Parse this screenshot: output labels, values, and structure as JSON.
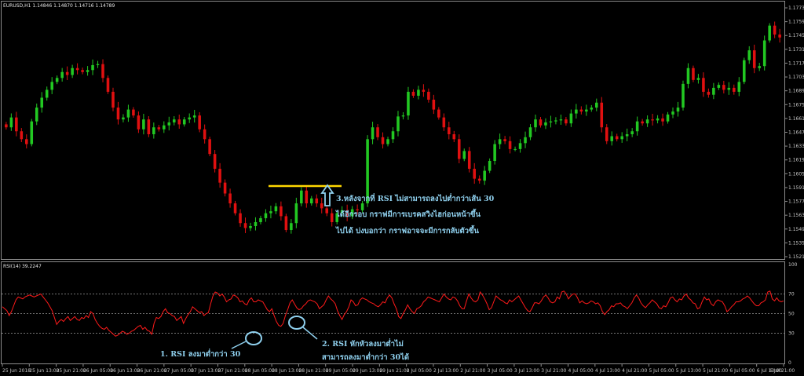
{
  "header": {
    "symbol": "EURUSD,H1",
    "ohlc": "1.14846 1.14870 1.14716 1.14789"
  },
  "rsi_header": {
    "label": "RSI(14) 39.2247"
  },
  "colors": {
    "bull": "#22c822",
    "bear": "#e01010",
    "rsi_line": "#ff1a1a",
    "resistance": "#ffd700",
    "annotation": "#8fd0ee",
    "grid_frame": "#8c8c8c"
  },
  "annotations": {
    "note3": [
      "3.หลังจากที่ RSI ไม่สามารถลงไปต่ำกว่าเส้น 30",
      "ได้อีกรอบ กราฟมีการเบรคสวิงไฮก่อนหน้าขึ้น",
      "ไปได้ บ่งบอกว่า กราฟอาจจะมีการกลับตัวขึ้น"
    ],
    "note1": "1. RSI ลงมาต่ำกว่า 30",
    "note2": [
      "2. RSI หักหัวลงมาต่ำไม่",
      "สามารถลงมาต่ำกว่า 30ได้"
    ]
  },
  "chart_data": [
    {
      "type": "candlestick",
      "title": "EURUSD,H1",
      "ylim": [
        1.1521,
        1.1773
      ],
      "y_ticks": [
        "1.17730",
        "1.17590",
        "1.17450",
        "1.17310",
        "1.17170",
        "1.17030",
        "1.16890",
        "1.16750",
        "1.16610",
        "1.16470",
        "1.16330",
        "1.16190",
        "1.16050",
        "1.15910",
        "1.15770",
        "1.15630",
        "1.15490",
        "1.15350",
        "1.15210"
      ],
      "x_ticks": [
        "25 Jun 2018",
        "25 Jun 13:00",
        "25 Jun 21:00",
        "26 Jun 05:00",
        "26 Jun 13:00",
        "26 Jun 21:00",
        "27 Jun 05:00",
        "27 Jun 13:00",
        "27 Jun 21:00",
        "28 Jun 05:00",
        "28 Jun 13:00",
        "28 Jun 21:00",
        "29 Jun 05:00",
        "29 Jun 13:00",
        "29 Jun 21:00",
        "2 Jul 05:00",
        "2 Jul 13:00",
        "2 Jul 21:00",
        "3 Jul 05:00",
        "3 Jul 13:00",
        "3 Jul 21:00",
        "4 Jul 05:00",
        "4 Jul 13:00",
        "4 Jul 21:00",
        "5 Jul 05:00",
        "5 Jul 13:00",
        "5 Jul 21:00",
        "6 Jul 05:00",
        "6 Jul 13:00",
        "6 Jul 21:00"
      ],
      "price_path": [
        1.1655,
        1.1652,
        1.1662,
        1.1648,
        1.164,
        1.1635,
        1.1658,
        1.1672,
        1.1682,
        1.169,
        1.1698,
        1.1702,
        1.1708,
        1.1705,
        1.1712,
        1.171,
        1.1708,
        1.171,
        1.1715,
        1.1716,
        1.1702,
        1.1688,
        1.1672,
        1.166,
        1.1662,
        1.167,
        1.1664,
        1.165,
        1.166,
        1.1645,
        1.1652,
        1.165,
        1.1654,
        1.1657,
        1.166,
        1.1655,
        1.166,
        1.1662,
        1.1664,
        1.165,
        1.164,
        1.1625,
        1.161,
        1.1596,
        1.1585,
        1.1575,
        1.1565,
        1.1555,
        1.155,
        1.1552,
        1.1556,
        1.156,
        1.1565,
        1.1567,
        1.1572,
        1.1562,
        1.1548,
        1.1555,
        1.1575,
        1.1588,
        1.1575,
        1.158,
        1.1575,
        1.157,
        1.1565,
        1.1556,
        1.1565,
        1.1568,
        1.1562,
        1.1569,
        1.1568,
        1.1575,
        1.164,
        1.1652,
        1.1642,
        1.1635,
        1.164,
        1.1648,
        1.1663,
        1.1664,
        1.1688,
        1.1684,
        1.169,
        1.1688,
        1.168,
        1.167,
        1.1662,
        1.1652,
        1.1645,
        1.164,
        1.162,
        1.1628,
        1.161,
        1.16,
        1.1598,
        1.1608,
        1.1618,
        1.1635,
        1.164,
        1.1638,
        1.163,
        1.163,
        1.1636,
        1.1642,
        1.1652,
        1.166,
        1.1654,
        1.1657,
        1.1658,
        1.1659,
        1.166,
        1.1656,
        1.1666,
        1.167,
        1.1668,
        1.167,
        1.1672,
        1.1677,
        1.1652,
        1.1638,
        1.1643,
        1.164,
        1.1643,
        1.1645,
        1.1648,
        1.1658,
        1.1656,
        1.166,
        1.1659,
        1.1661,
        1.1658,
        1.1665,
        1.1668,
        1.1672,
        1.1696,
        1.1712,
        1.17,
        1.1702,
        1.1688,
        1.1685,
        1.1692,
        1.1695,
        1.169,
        1.1692,
        1.1688,
        1.1698,
        1.172,
        1.173,
        1.1712,
        1.1714,
        1.174,
        1.1755,
        1.1746,
        1.1743
      ]
    },
    {
      "type": "line",
      "title": "RSI(14) 39.2247",
      "ylim": [
        0,
        100
      ],
      "levels": [
        70,
        50,
        30
      ],
      "y_ticks": [
        "100",
        "70",
        "50",
        "30",
        "0"
      ],
      "values": [
        57,
        55,
        53,
        48,
        52,
        58,
        64,
        67,
        66,
        65,
        67,
        68,
        69,
        68,
        67,
        68,
        69,
        70,
        67,
        64,
        61,
        57,
        53,
        46,
        39,
        42,
        44,
        42,
        45,
        47,
        43,
        45,
        47,
        44,
        43,
        46,
        45,
        48,
        46,
        52,
        50,
        44,
        40,
        37,
        35,
        34,
        36,
        33,
        31,
        29,
        27,
        28,
        30,
        32,
        31,
        29,
        30,
        32,
        33,
        35,
        37,
        38,
        34,
        36,
        33,
        32,
        29,
        40,
        46,
        45,
        47,
        52,
        55,
        51,
        50,
        48,
        47,
        43,
        45,
        47,
        40,
        45,
        49,
        52,
        57,
        55,
        53,
        51,
        52,
        48,
        50,
        51,
        60,
        68,
        72,
        71,
        68,
        70,
        67,
        62,
        64,
        65,
        69,
        68,
        66,
        62,
        63,
        60,
        59,
        64,
        66,
        62,
        62,
        64,
        63,
        62,
        58,
        54,
        52,
        55,
        48,
        42,
        38,
        37,
        40,
        48,
        54,
        61,
        64,
        60,
        56,
        54,
        55,
        58,
        60,
        63,
        64,
        63,
        62,
        60,
        55,
        57,
        59,
        64,
        68,
        65,
        63,
        60,
        53,
        48,
        44,
        49,
        52,
        57,
        64,
        62,
        58,
        59,
        64,
        66,
        65,
        64,
        62,
        61,
        60,
        58,
        57,
        59,
        62,
        61,
        66,
        69,
        66,
        60,
        55,
        47,
        45,
        50,
        54,
        59,
        55,
        52,
        50,
        55,
        56,
        58,
        62,
        64,
        67,
        66,
        65,
        64,
        63,
        62,
        66,
        70,
        67,
        65,
        64,
        67,
        66,
        63,
        58,
        55,
        55,
        63,
        70,
        66,
        63,
        62,
        64,
        72,
        69,
        65,
        60,
        54,
        56,
        62,
        68,
        66,
        64,
        63,
        61,
        60,
        64,
        62,
        64,
        66,
        68,
        64,
        60,
        56,
        53,
        52,
        56,
        61,
        61,
        60,
        63,
        67,
        69,
        66,
        62,
        61,
        62,
        67,
        65,
        72,
        73,
        70,
        65,
        68,
        70,
        70,
        66,
        61,
        63,
        61,
        60,
        61,
        63,
        62,
        60,
        61,
        58,
        52,
        49,
        52,
        54,
        58,
        57,
        60,
        60,
        61,
        58,
        57,
        55,
        58,
        61,
        66,
        69,
        66,
        61,
        58,
        56,
        59,
        61,
        64,
        62,
        60,
        56,
        55,
        58,
        57,
        61,
        66,
        67,
        64,
        62,
        65,
        64,
        68,
        70,
        66,
        64,
        61,
        60,
        55,
        56,
        62,
        67,
        64,
        65,
        60,
        58,
        62,
        64,
        63,
        62,
        58,
        52,
        54,
        57,
        59,
        62,
        62,
        63,
        65,
        66,
        68,
        66,
        63,
        60,
        58,
        58,
        61,
        62,
        64,
        72,
        73,
        65,
        63,
        66,
        63,
        62,
        63
      ]
    }
  ]
}
